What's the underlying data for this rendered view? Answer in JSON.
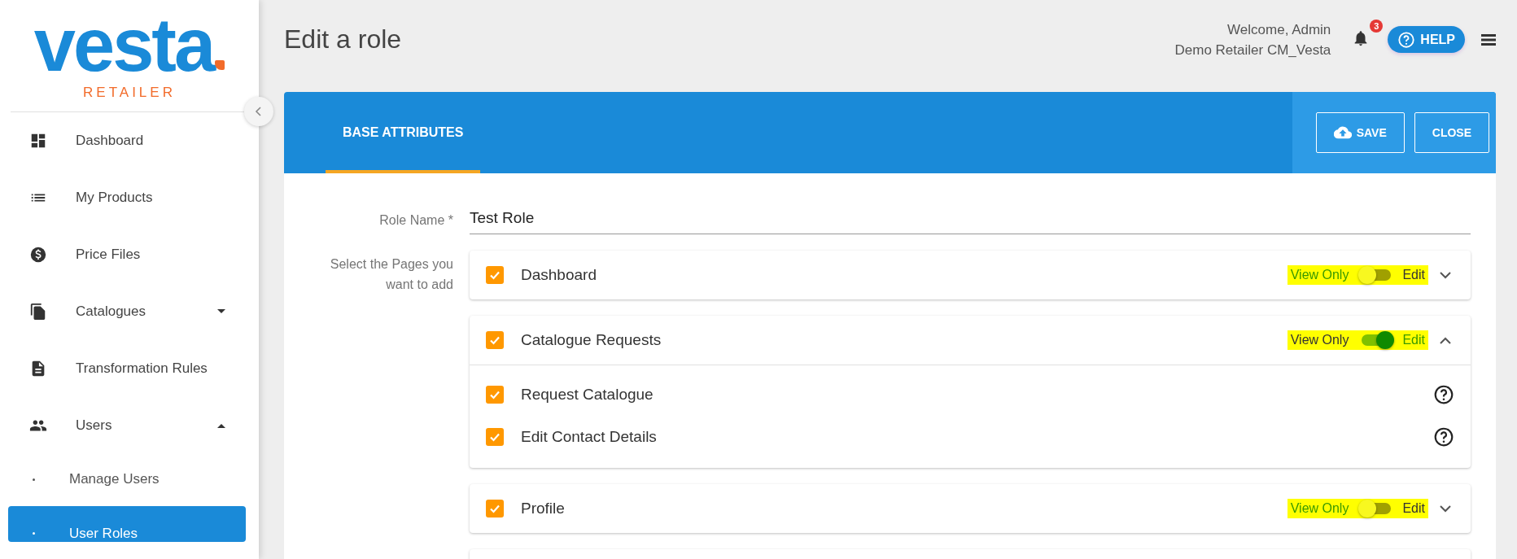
{
  "logo": {
    "wordmark": "vesta",
    "subtitle": "RETAILER"
  },
  "sidebar": {
    "items": [
      {
        "label": "Dashboard",
        "kind": "link",
        "selected": false
      },
      {
        "label": "My Products",
        "kind": "link",
        "selected": false
      },
      {
        "label": "Price Files",
        "kind": "link",
        "selected": false
      },
      {
        "label": "Catalogues",
        "kind": "group",
        "selected": false,
        "expanded": false
      },
      {
        "label": "Transformation Rules",
        "kind": "link",
        "selected": false
      },
      {
        "label": "Users",
        "kind": "group",
        "selected": false,
        "expanded": true,
        "children": [
          {
            "label": "Manage Users",
            "selected": false
          },
          {
            "label": "User Roles",
            "selected": true
          }
        ]
      }
    ]
  },
  "header": {
    "title": "Edit a role",
    "welcome": "Welcome, Admin",
    "organisation": "Demo Retailer CM_Vesta",
    "notification_count": "3",
    "help": "HELP"
  },
  "toolbar": {
    "tabs": [
      {
        "label": "BASE ATTRIBUTES",
        "selected": true
      }
    ],
    "buttons": [
      "SAVE",
      "CLOSE"
    ]
  },
  "form": {
    "role_name": {
      "label": "Role Name *",
      "value": "Test Role"
    },
    "pages_label": "Select the Pages you want to add",
    "pages": [
      {
        "label": "Dashboard",
        "checked": true,
        "expanded": false,
        "toggle": {
          "left": "View Only",
          "right": "Edit",
          "on": false
        }
      },
      {
        "label": "Catalogue Requests",
        "checked": true,
        "expanded": true,
        "toggle": {
          "left": "View Only",
          "right": "Edit",
          "on": true
        },
        "children": [
          {
            "label": "Request Catalogue",
            "checked": true
          },
          {
            "label": "Edit Contact Details",
            "checked": true
          }
        ]
      },
      {
        "label": "Profile",
        "checked": true,
        "expanded": false,
        "toggle": {
          "left": "View Only",
          "right": "Edit",
          "on": false
        }
      }
    ]
  }
}
